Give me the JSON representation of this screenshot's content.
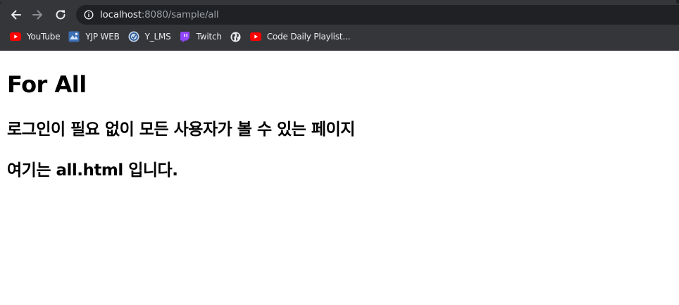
{
  "browser": {
    "url_host": "localhost",
    "url_rest": ":8080/sample/all",
    "bookmarks": [
      {
        "label": "YouTube",
        "icon": "youtube-icon"
      },
      {
        "label": "YJP WEB",
        "icon": "yjp-web-icon"
      },
      {
        "label": "Y_LMS",
        "icon": "y-lms-icon"
      },
      {
        "label": "Twitch",
        "icon": "twitch-icon"
      },
      {
        "label": "",
        "icon": "globe-icon"
      },
      {
        "label": "Code Daily Playlist...",
        "icon": "youtube-icon"
      }
    ],
    "colors": {
      "chrome": "#35363a",
      "omnibox": "#202124",
      "youtube_red": "#ff0000",
      "twitch_purple": "#9146ff"
    }
  },
  "page": {
    "title": "For All",
    "subtitle": "로그인이 필요 없이 모든 사용자가 볼 수 있는 페이지",
    "body": "여기는 all.html 입니다."
  }
}
